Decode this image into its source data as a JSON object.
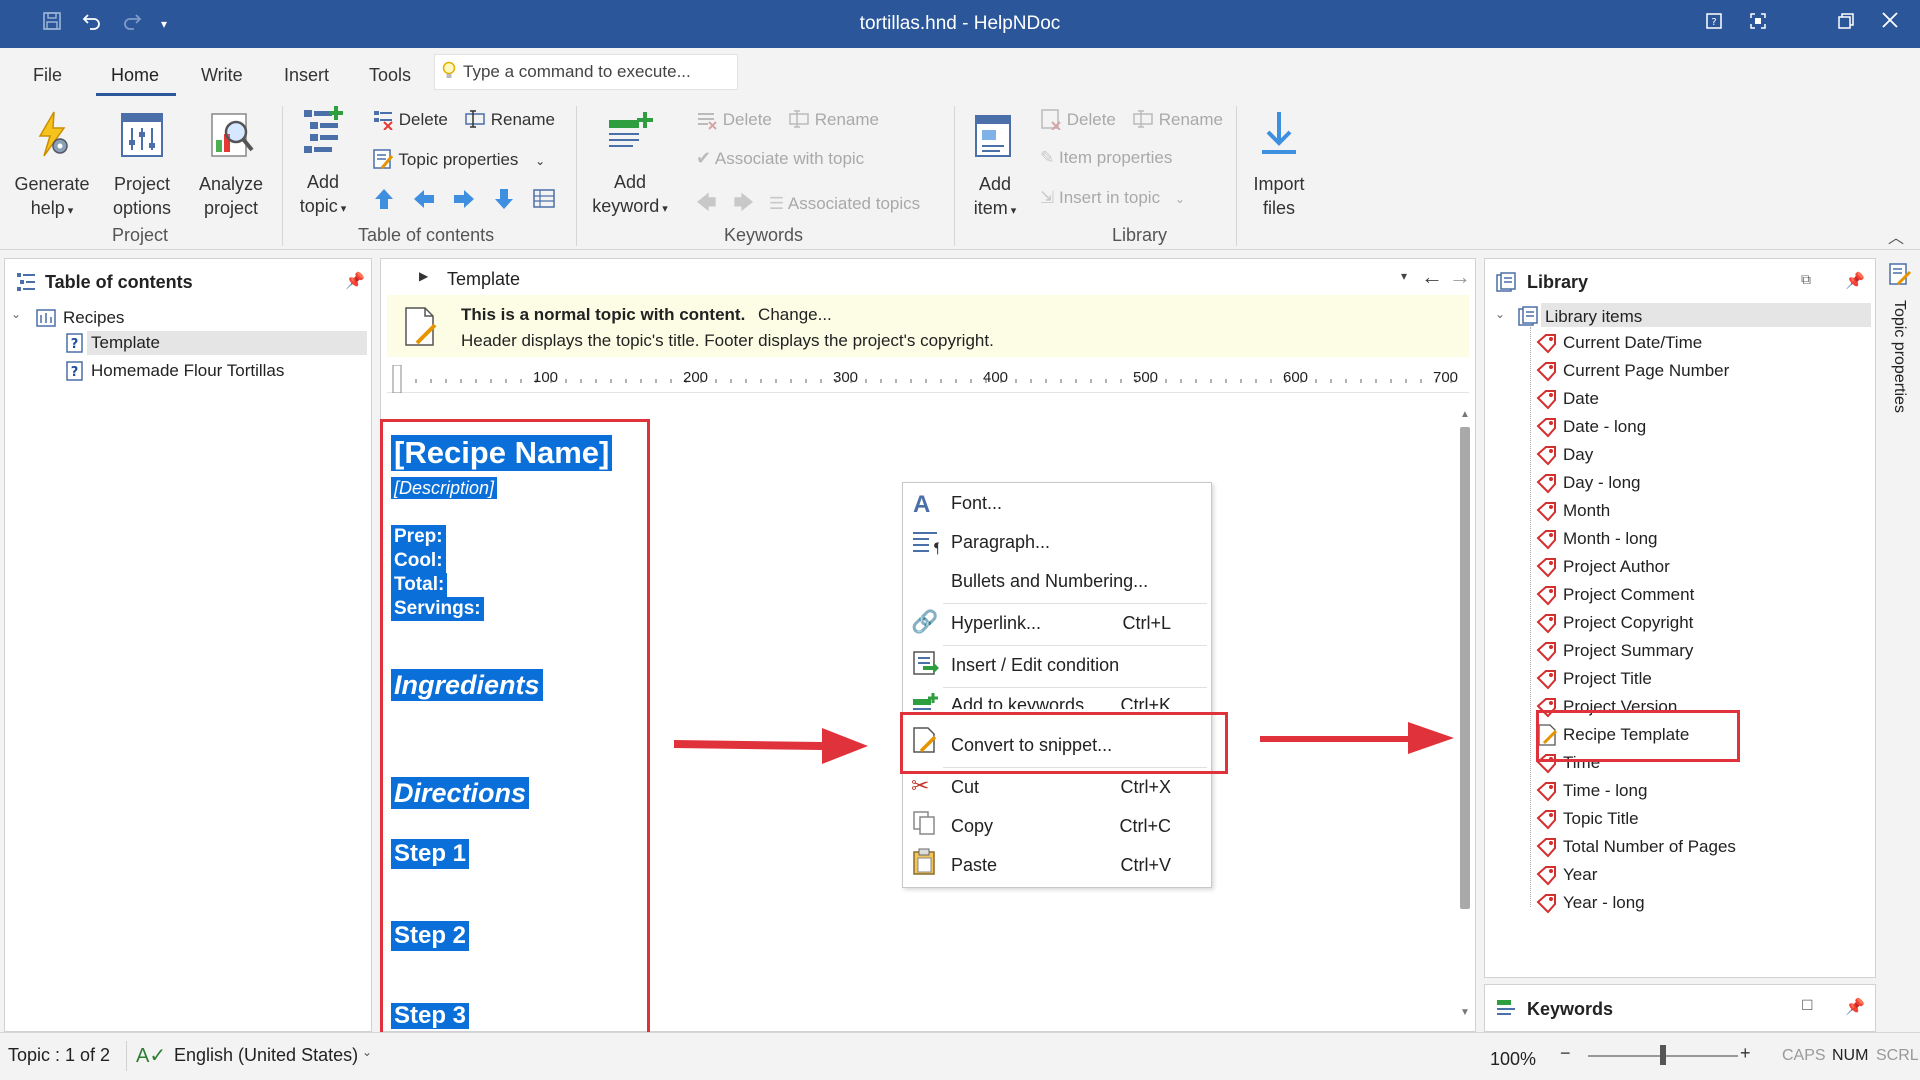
{
  "window": {
    "title": "tortillas.hnd - HelpNDoc"
  },
  "menu": {
    "tabs": [
      "File",
      "Home",
      "Write",
      "Insert",
      "Tools"
    ],
    "command_placeholder": "Type a command to execute..."
  },
  "ribbon": {
    "project": {
      "generate_help": [
        "Generate",
        "help"
      ],
      "project_options": [
        "Project",
        "options"
      ],
      "analyze_project": [
        "Analyze",
        "project"
      ],
      "group_label": "Project"
    },
    "toc": {
      "add_topic": [
        "Add",
        "topic"
      ],
      "delete": "Delete",
      "rename": "Rename",
      "topic_properties": "Topic properties",
      "group_label": "Table of contents"
    },
    "keywords": {
      "add_keyword": [
        "Add",
        "keyword"
      ],
      "delete": "Delete",
      "rename": "Rename",
      "associate": "Associate with topic",
      "associated_topics": "Associated topics",
      "group_label": "Keywords"
    },
    "library": {
      "add_item": [
        "Add",
        "item"
      ],
      "delete": "Delete",
      "rename": "Rename",
      "item_properties": "Item properties",
      "insert_in_topic": "Insert in topic",
      "group_label": "Library"
    },
    "import": {
      "label": [
        "Import",
        "files"
      ]
    }
  },
  "toc_panel": {
    "title": "Table of contents",
    "root": "Recipes",
    "items": [
      "Template",
      "Homemade Flour Tortillas"
    ]
  },
  "editor": {
    "breadcrumb": "Template",
    "info_bold": "This is a normal topic with content.",
    "info_change": "Change...",
    "info_line2": "Header displays the topic's title.  Footer displays the project's copyright.",
    "ruler_labels": [
      "100",
      "200",
      "300",
      "400",
      "500",
      "600",
      "700"
    ],
    "content": {
      "recipe_name": "[Recipe Name]",
      "description": "[Description]",
      "fields": [
        "Prep:",
        "Cool:",
        "Total:",
        "Servings:"
      ],
      "ingredients": "Ingredients",
      "directions": "Directions",
      "steps": [
        "Step 1",
        "Step 2",
        "Step 3"
      ]
    }
  },
  "context_menu": {
    "items": [
      {
        "label": "Font...",
        "shortcut": ""
      },
      {
        "label": "Paragraph...",
        "shortcut": ""
      },
      {
        "label": "Bullets and Numbering...",
        "shortcut": ""
      },
      {
        "label": "Hyperlink...",
        "shortcut": "Ctrl+L"
      },
      {
        "label": "Insert / Edit condition",
        "shortcut": ""
      },
      {
        "label": "Add to keywords",
        "shortcut": "Ctrl+K"
      },
      {
        "label": "Convert to snippet...",
        "shortcut": ""
      },
      {
        "label": "Cut",
        "shortcut": "Ctrl+X"
      },
      {
        "label": "Copy",
        "shortcut": "Ctrl+C"
      },
      {
        "label": "Paste",
        "shortcut": "Ctrl+V"
      }
    ]
  },
  "library_panel": {
    "title": "Library",
    "root": "Library items",
    "items": [
      "Current Date/Time",
      "Current Page Number",
      "Date",
      "Date - long",
      "Day",
      "Day - long",
      "Month",
      "Month - long",
      "Project Author",
      "Project Comment",
      "Project Copyright",
      "Project Summary",
      "Project Title",
      "Project Version",
      "Recipe Template",
      "Time",
      "Time - long",
      "Topic Title",
      "Total Number of Pages",
      "Year",
      "Year - long"
    ]
  },
  "keywords_panel": {
    "title": "Keywords"
  },
  "side_tab": {
    "label": "Topic properties"
  },
  "status": {
    "topic": "Topic : 1 of 2",
    "language": "English (United States)",
    "zoom": "100%",
    "caps": "CAPS",
    "num": "NUM",
    "scrl": "SCRL"
  },
  "colors": {
    "titlebar": "#2b579a",
    "selection": "#0a6fd8",
    "highlight_box": "#e0323a",
    "info_bar": "#fdfde6"
  }
}
